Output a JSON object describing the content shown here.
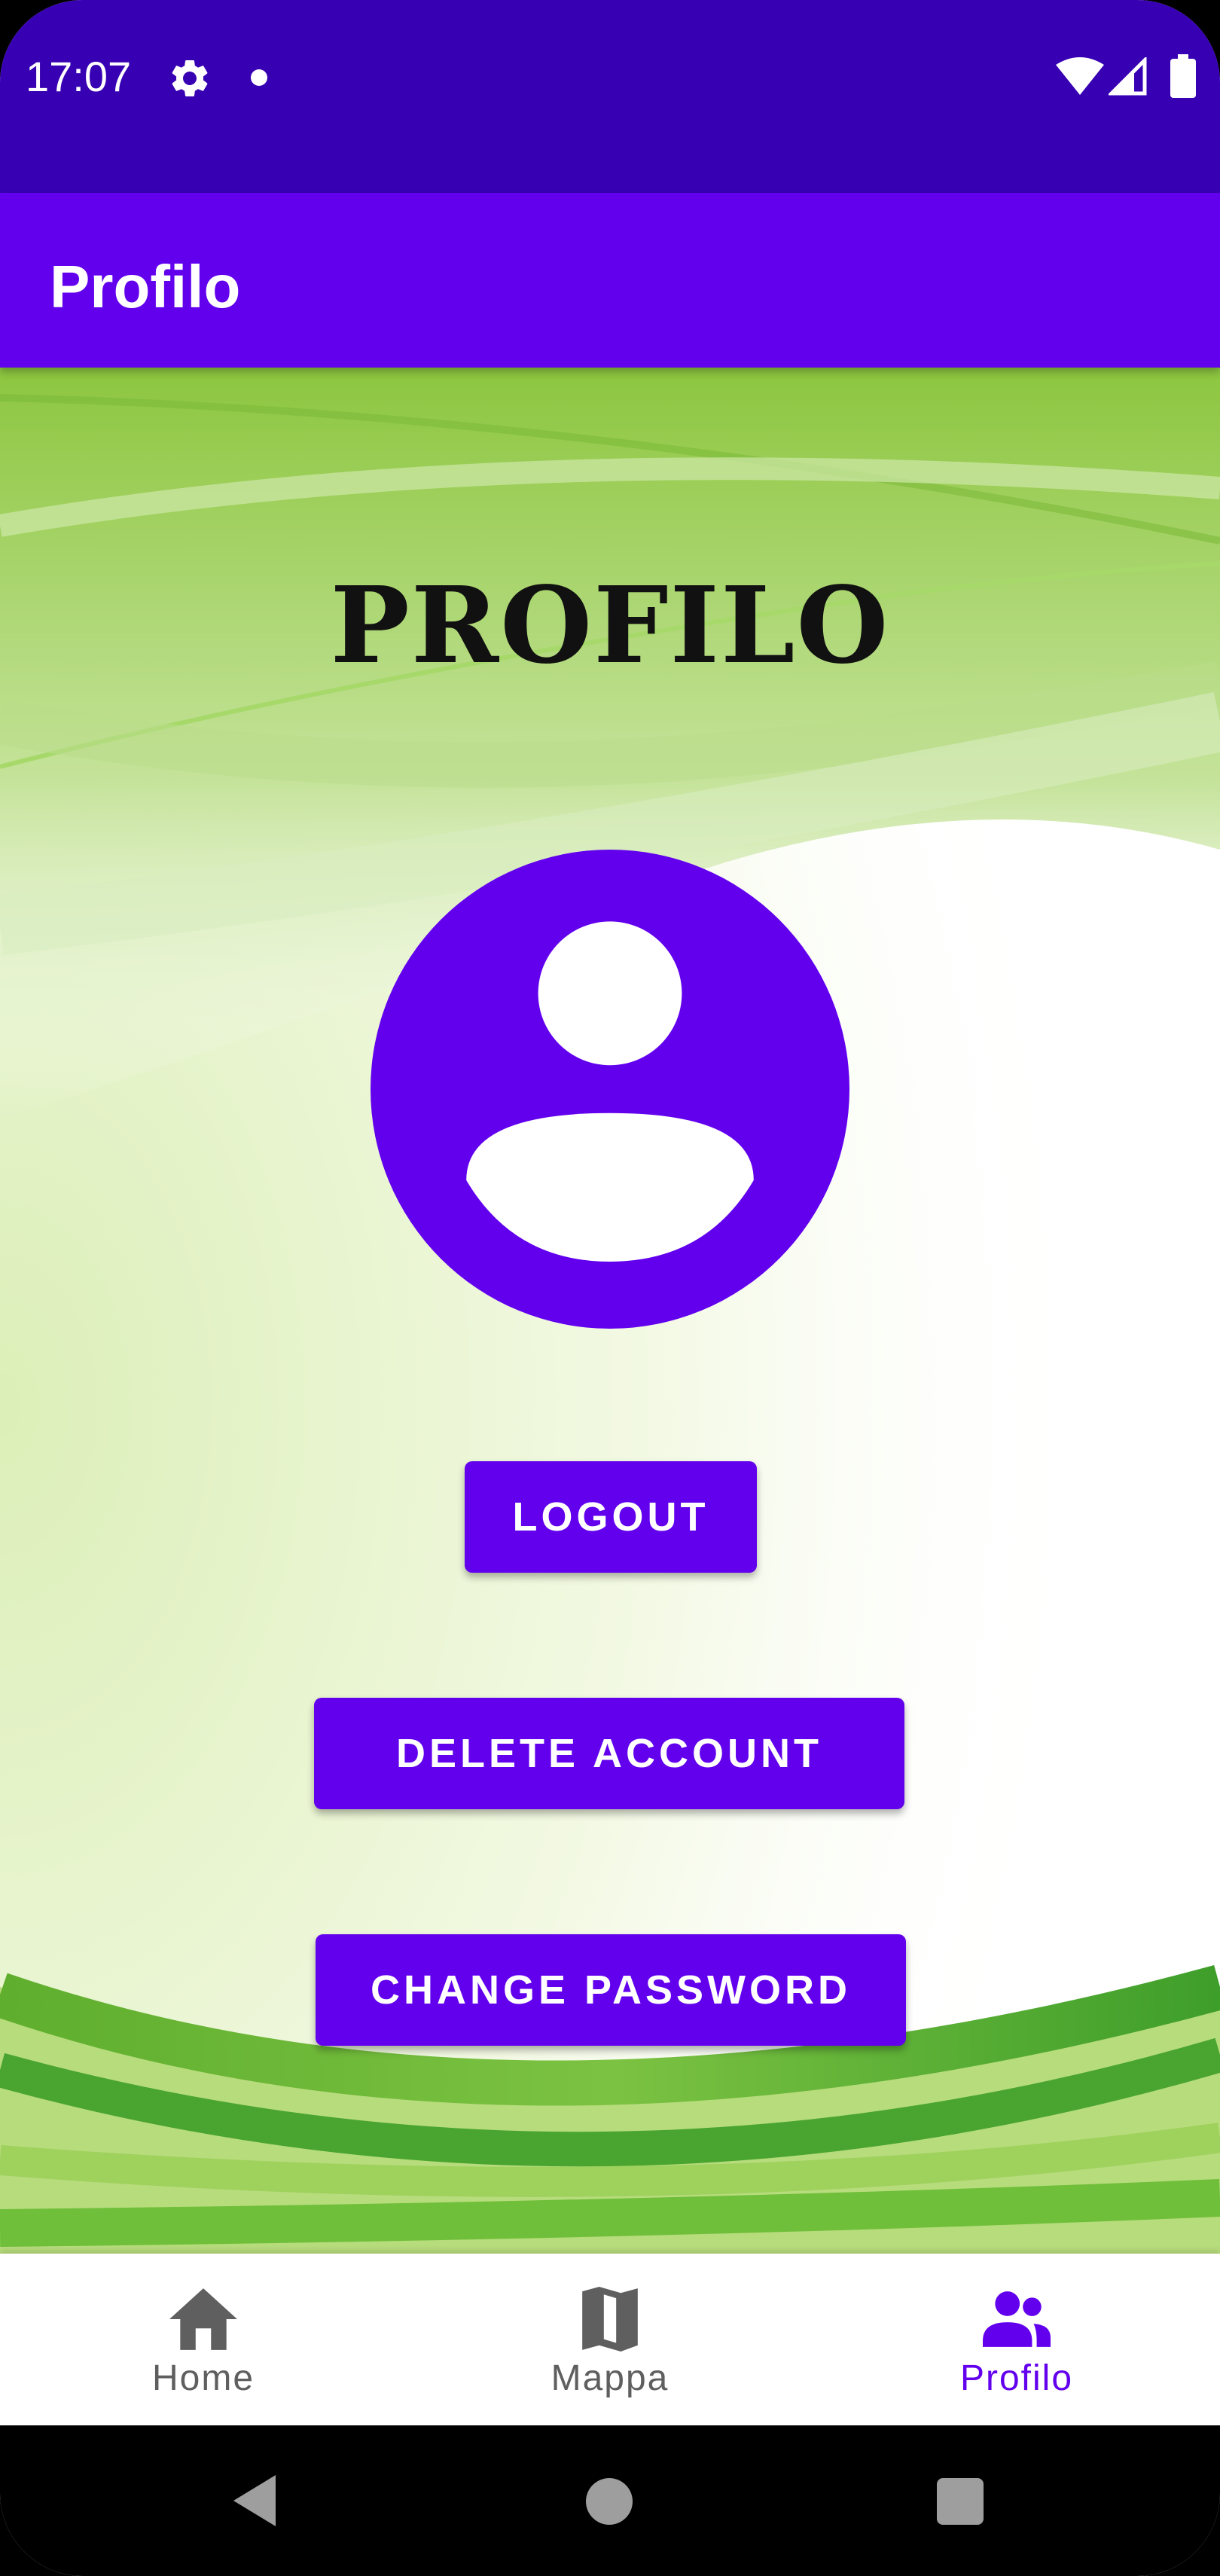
{
  "status_bar": {
    "time": "17:07",
    "icons": [
      "gear-icon",
      "notification-dot-icon",
      "wifi-icon",
      "signal-icon",
      "battery-icon"
    ]
  },
  "app_bar": {
    "title": "Profilo"
  },
  "main": {
    "heading": "PROFILO",
    "avatar_icon": "account-circle-icon",
    "buttons": {
      "logout": "LOGOUT",
      "delete_account": "DELETE ACCOUNT",
      "change_password": "CHANGE PASSWORD"
    }
  },
  "bottom_nav": {
    "items": [
      {
        "label": "Home",
        "icon": "home-icon",
        "active": false
      },
      {
        "label": "Mappa",
        "icon": "map-icon",
        "active": false
      },
      {
        "label": "Profilo",
        "icon": "people-icon",
        "active": true
      }
    ]
  },
  "system_nav": {
    "icons": [
      "back-icon",
      "home-circle-icon",
      "recents-square-icon"
    ]
  },
  "colors": {
    "status_bar": "#3700b3",
    "primary": "#6200ee",
    "nav_inactive": "#5f5f5f",
    "background_green": "#8cc63f"
  }
}
